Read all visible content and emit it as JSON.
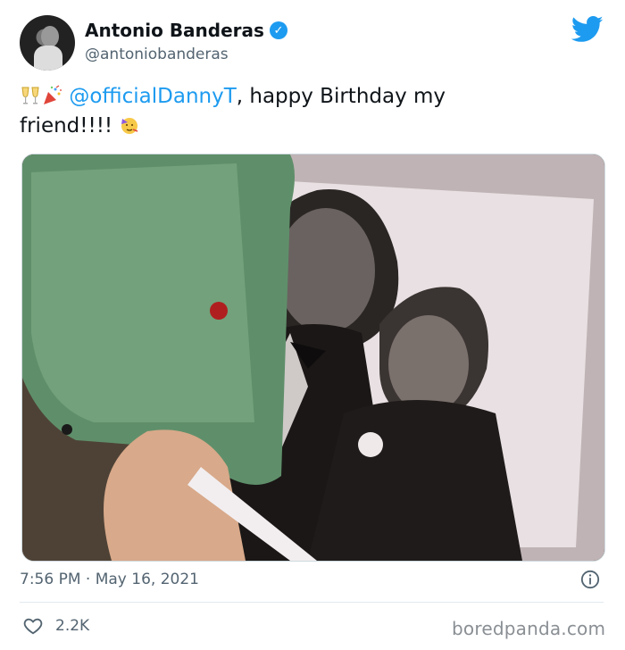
{
  "author": {
    "display_name": "Antonio Banderas",
    "handle": "@antoniobanderas",
    "verified_icon": "verified-badge-icon"
  },
  "brand": {
    "logo_icon": "twitter-bird-icon",
    "color": "#1d9bf0"
  },
  "tweet": {
    "mention": "@officialDannyT",
    "text_part1": ", happy Birthday my",
    "text_part2": "friend!!!! ",
    "emojis": [
      "clinking-glasses-emoji",
      "party-popper-emoji",
      "partying-face-emoji"
    ],
    "photo": "two-men-in-tuxedos-photo",
    "timestamp": "7:56 PM · May 16, 2021"
  },
  "stats": {
    "likes": "2.2K",
    "like_icon": "heart-icon",
    "info_icon": "info-icon"
  },
  "watermark": "boredpanda.com"
}
